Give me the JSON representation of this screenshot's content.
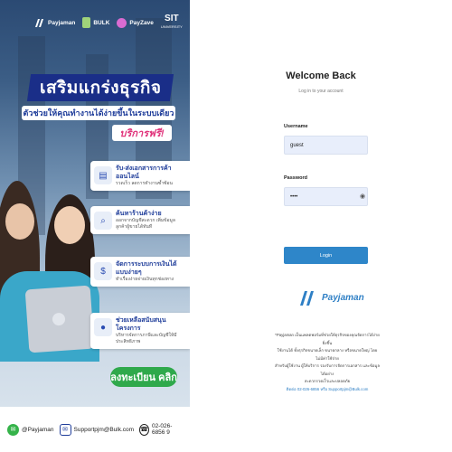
{
  "banner": {
    "logos": [
      {
        "name": "Payjaman"
      },
      {
        "name": "BULK"
      },
      {
        "name": "PayZave"
      },
      {
        "name": "SIT",
        "sub": "UNIVERSITY"
      }
    ],
    "headline": "เสริมแกร่งธุรกิจ",
    "subline": "ตัวช่วยให้คุณทำงานได้ง่ายขึ้นในระบบเดียว",
    "free_badge": "บริการฟรี!",
    "features": [
      {
        "icon": "document-icon",
        "title": "รับ-ส่งเอกสารการค้าออนไลน์",
        "desc": "รวดเร็ว ลดการทำงานซ้ำซ้อน"
      },
      {
        "icon": "search-icon",
        "title": "ค้นหาร้านค้าง่าย",
        "desc": "ออกจากบัญชีสะดวก เพิ่มข้อมูลลูกค้าผู้ขายได้ทันที"
      },
      {
        "icon": "payment-icon",
        "title": "จัดการระบบการเงินได้แบบง่ายๆ",
        "desc": "ทำเรื่องง่ายจ่ายเงินทุกช่องทาง"
      },
      {
        "icon": "piggy-bank-icon",
        "title": "ช่วยเหลือสนับสนุนโครงการ",
        "desc": "บริหารจัดการภาษีและบัญชีให้มีประสิทธิภาพ"
      }
    ],
    "register_label": "ลงทะเบียน คลิก",
    "contact": {
      "line": "@Payjaman",
      "email": "Supportpjm@Bulk.com",
      "phone": "02-026-6856 9"
    }
  },
  "login": {
    "title": "Welcome Back",
    "subtitle": "Log in to your account",
    "username_label": "Username",
    "username_value": "guest",
    "password_label": "Password",
    "password_value": "••••",
    "login_button": "Login",
    "brand": "Payjaman",
    "note_lines": [
      "*Payjaman เป็นแพลตฟอร์มที่ช่วยให้ธุรกิจของคุณจัดการได้ง่ายยิ่งขึ้น",
      "ใช้งานได้ ทั้งธุรกิจขนาดเล็ก ขนาดกลาง หรือขนาดใหญ่ โดยไม่มีค่าใช้จ่าย",
      "สำหรับผู้ใช้งาน ผู้ให้บริการ รองรับการจัดการเอกสาร และข้อมูลได้อย่าง",
      "สะดวกรวดเร็วและปลอดภัย",
      "ติดต่อ 02-026-6856 หรือ Supportpjm@Bulk.com"
    ]
  },
  "colors": {
    "headline_bg": "#1a2e88",
    "accent_blue": "#2e86c9",
    "register_green": "#2fa94b",
    "input_bg": "#e8eefb"
  }
}
